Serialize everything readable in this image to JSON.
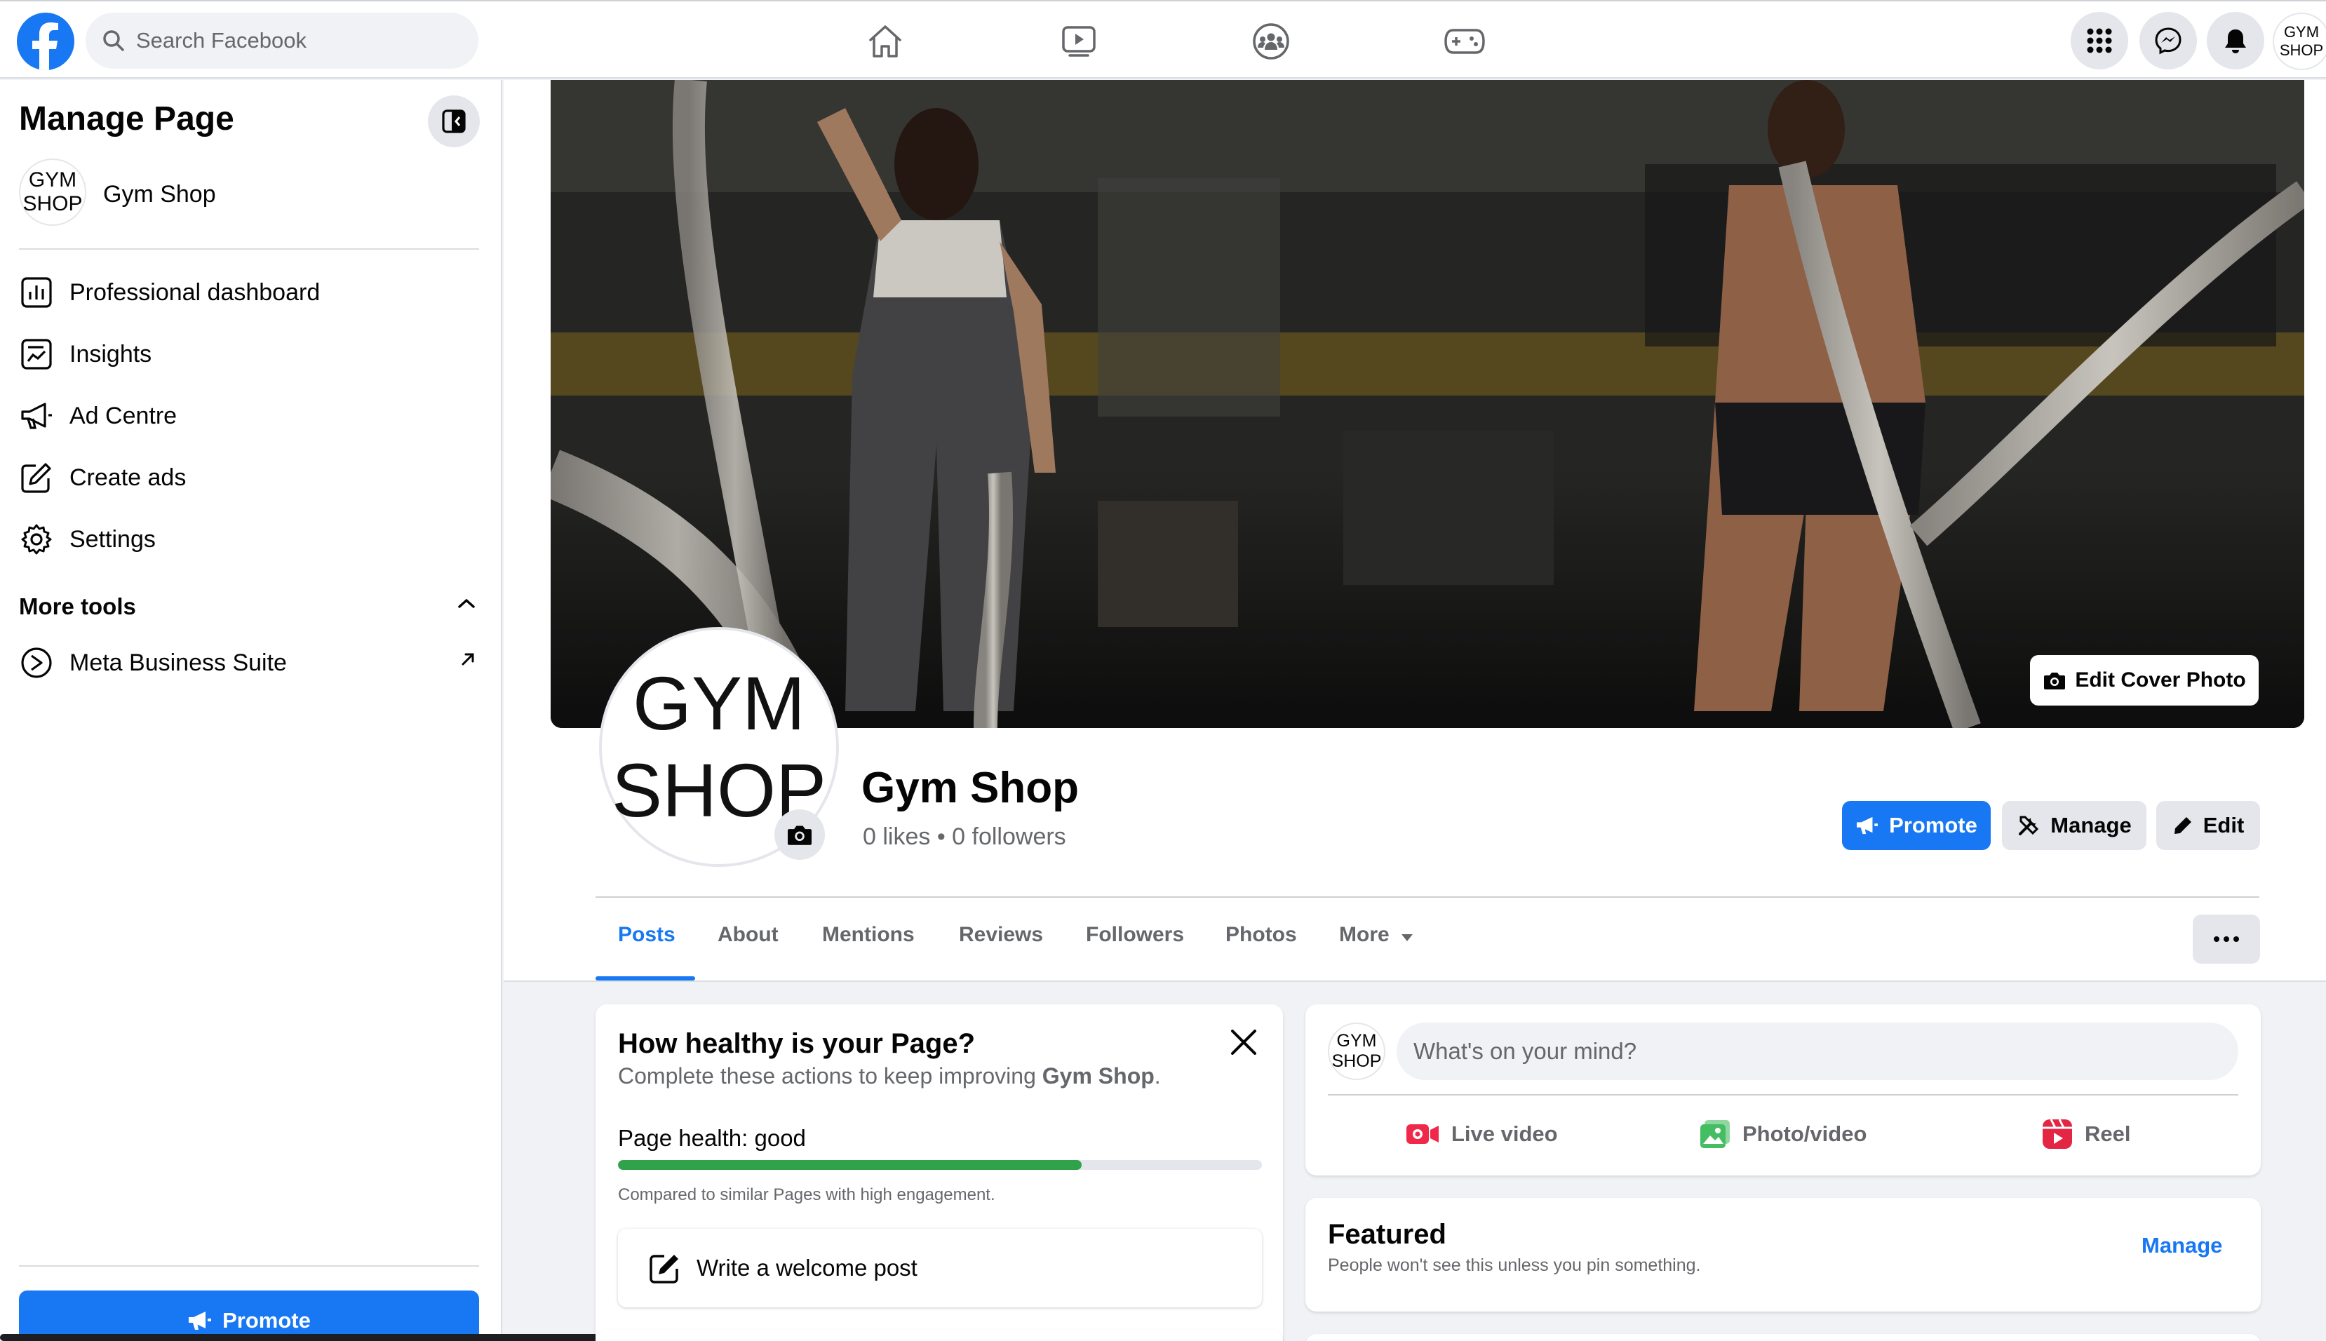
{
  "topbar": {
    "search_placeholder": "Search Facebook",
    "nav_icons": [
      "home-icon",
      "video-icon",
      "groups-icon",
      "gaming-icon"
    ],
    "right_icons": [
      "menu-grid-icon",
      "messenger-icon",
      "notifications-icon"
    ],
    "avatar_line1": "GYM",
    "avatar_line2": "SHOP"
  },
  "sidebar": {
    "title": "Manage Page",
    "page_avatar_line1": "GYM",
    "page_avatar_line2": "SHOP",
    "page_name": "Gym Shop",
    "items": [
      {
        "label": "Professional dashboard",
        "icon": "dashboard-icon"
      },
      {
        "label": "Insights",
        "icon": "insights-icon"
      },
      {
        "label": "Ad Centre",
        "icon": "megaphone-icon"
      },
      {
        "label": "Create ads",
        "icon": "edit-square-icon"
      },
      {
        "label": "Settings",
        "icon": "gear-icon"
      }
    ],
    "more_tools_label": "More tools",
    "meta_business_label": "Meta Business Suite",
    "promote_label": "Promote"
  },
  "header": {
    "edit_cover_label": "Edit Cover Photo",
    "avatar_line1": "GYM",
    "avatar_line2": "SHOP",
    "page_name": "Gym Shop",
    "stats": "0 likes • 0 followers",
    "promote_label": "Promote",
    "manage_label": "Manage",
    "edit_label": "Edit",
    "tabs": [
      "Posts",
      "About",
      "Mentions",
      "Reviews",
      "Followers",
      "Photos",
      "More"
    ],
    "active_tab": "Posts"
  },
  "health_card": {
    "title": "How healthy is your Page?",
    "subtitle_prefix": "Complete these actions to keep improving ",
    "subtitle_page": "Gym Shop",
    "subtitle_suffix": ".",
    "health_label": "Page health: good",
    "health_fraction": 0.72,
    "note": "Compared to similar Pages with high engagement.",
    "welcome_label": "Write a welcome post"
  },
  "composer": {
    "avatar_line1": "GYM",
    "avatar_line2": "SHOP",
    "placeholder": "What's on your mind?",
    "live_label": "Live video",
    "photo_label": "Photo/video",
    "reel_label": "Reel"
  },
  "featured": {
    "title": "Featured",
    "subtitle": "People won't see this unless you pin something.",
    "manage_label": "Manage"
  },
  "colors": {
    "brand": "#1877f2",
    "health_green": "#31a24c",
    "live_red": "#f02849",
    "photo_green": "#45bd62",
    "reel_pink": "#e42645"
  }
}
